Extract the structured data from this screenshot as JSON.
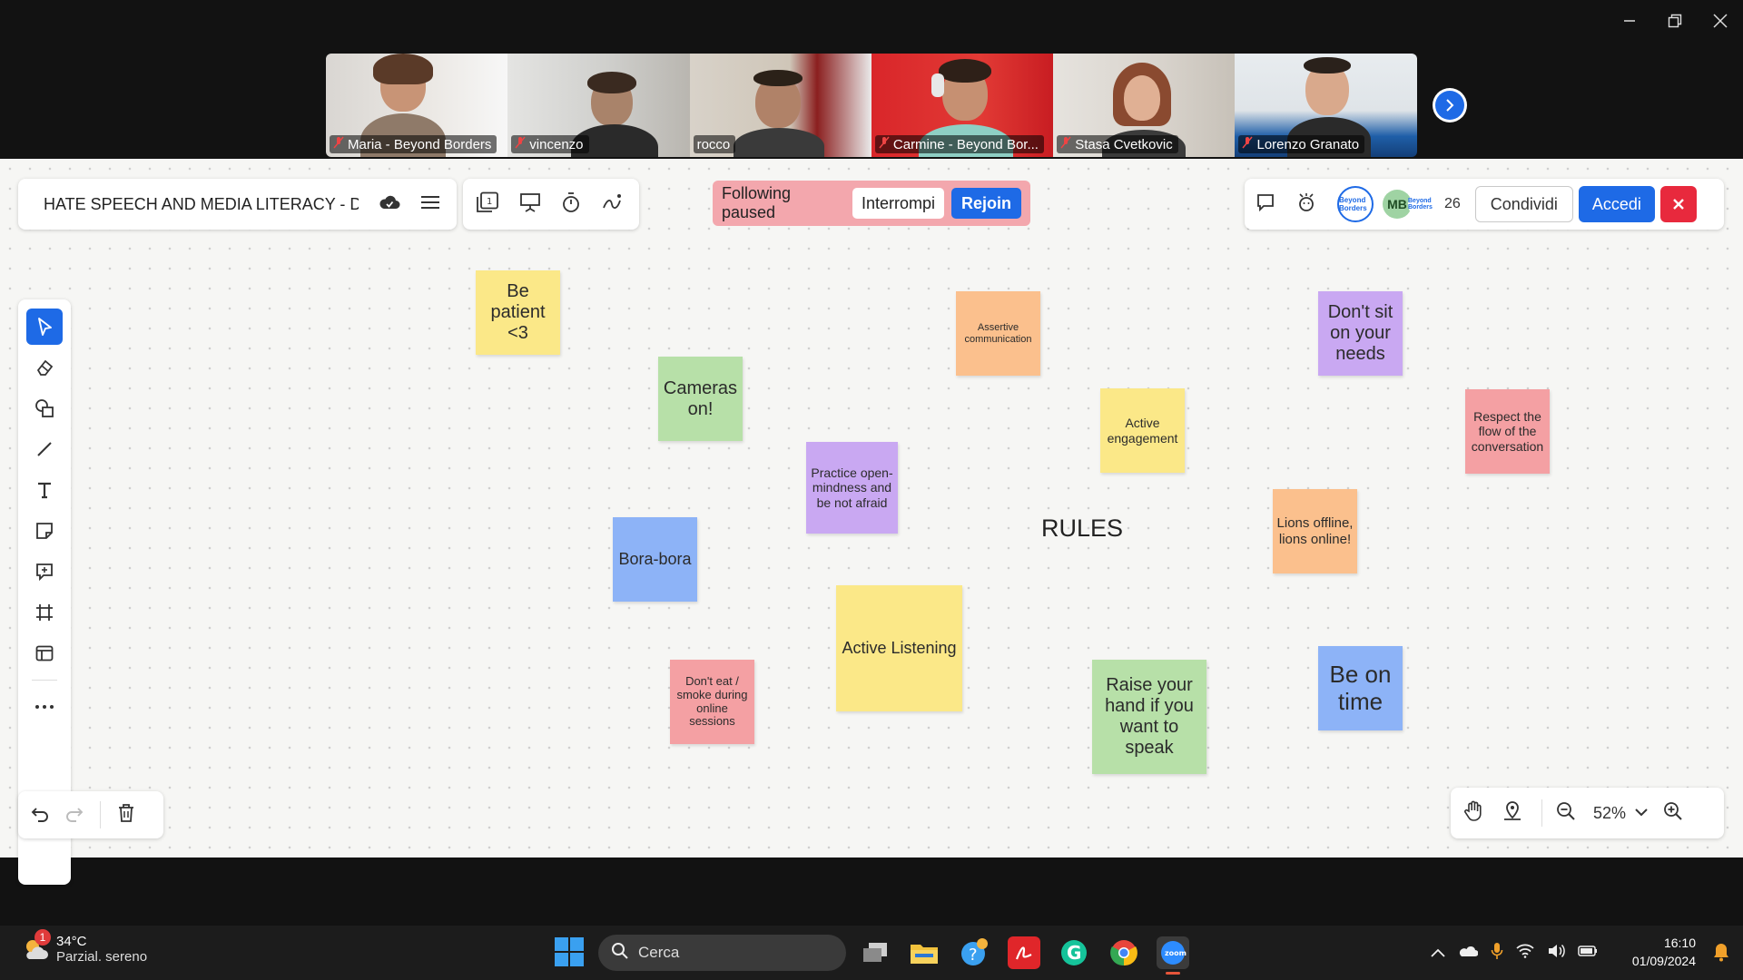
{
  "window": {
    "controls": [
      "minimize",
      "restore",
      "close"
    ]
  },
  "participants": [
    {
      "name": "Maria - Beyond Borders",
      "muted": true
    },
    {
      "name": "vincenzo",
      "muted": true
    },
    {
      "name": "rocco",
      "muted": false,
      "active_speaker": true
    },
    {
      "name": "Carmine - Beyond Bor...",
      "muted": true
    },
    {
      "name": "Stasa Cvetkovic",
      "muted": true
    },
    {
      "name": "Lorenzo Granato",
      "muted": true
    }
  ],
  "whiteboard": {
    "title": "HATE SPEECH AND MEDIA LITERACY - DA...",
    "following": {
      "status": "Following paused",
      "stop_label": "Interrompi",
      "rejoin_label": "Rejoin"
    },
    "collaborators": {
      "avatar_1": "Beyond Borders",
      "initials": "MB",
      "avatar_3": "Beyond Borders",
      "count": "26"
    },
    "share_label": "Condividi",
    "signin_label": "Accedi",
    "zoom_level": "52%",
    "rules_label": "RULES",
    "notes": [
      {
        "text": "Be patient <3",
        "color": "yellow"
      },
      {
        "text": "Cameras on!",
        "color": "green"
      },
      {
        "text": "Assertive communication",
        "color": "orange"
      },
      {
        "text": "Don't sit on your needs",
        "color": "purple"
      },
      {
        "text": "Active engagement",
        "color": "yellow"
      },
      {
        "text": "Respect the flow of the conversation",
        "color": "red"
      },
      {
        "text": "Practice open-mindness  and be not afraid",
        "color": "purple"
      },
      {
        "text": "Bora-bora",
        "color": "blue"
      },
      {
        "text": "Lions offline, lions online!",
        "color": "orange"
      },
      {
        "text": "Active Listening",
        "color": "yellow"
      },
      {
        "text": "Don't eat / smoke during online sessions",
        "color": "red"
      },
      {
        "text": "Raise your hand if you want to speak",
        "color": "green"
      },
      {
        "text": "Be on time",
        "color": "blue"
      }
    ]
  },
  "taskbar": {
    "weather": {
      "temp": "34°C",
      "desc": "Parzial. sereno",
      "badge": "1"
    },
    "search_placeholder": "Cerca",
    "clock": {
      "time": "16:10",
      "date": "01/09/2024"
    }
  },
  "colors": {
    "accent": "#1e6ae6",
    "follow_bar": "#f3a7ad",
    "close_red": "#e8293d",
    "active_speaker": "#2fd07c"
  }
}
